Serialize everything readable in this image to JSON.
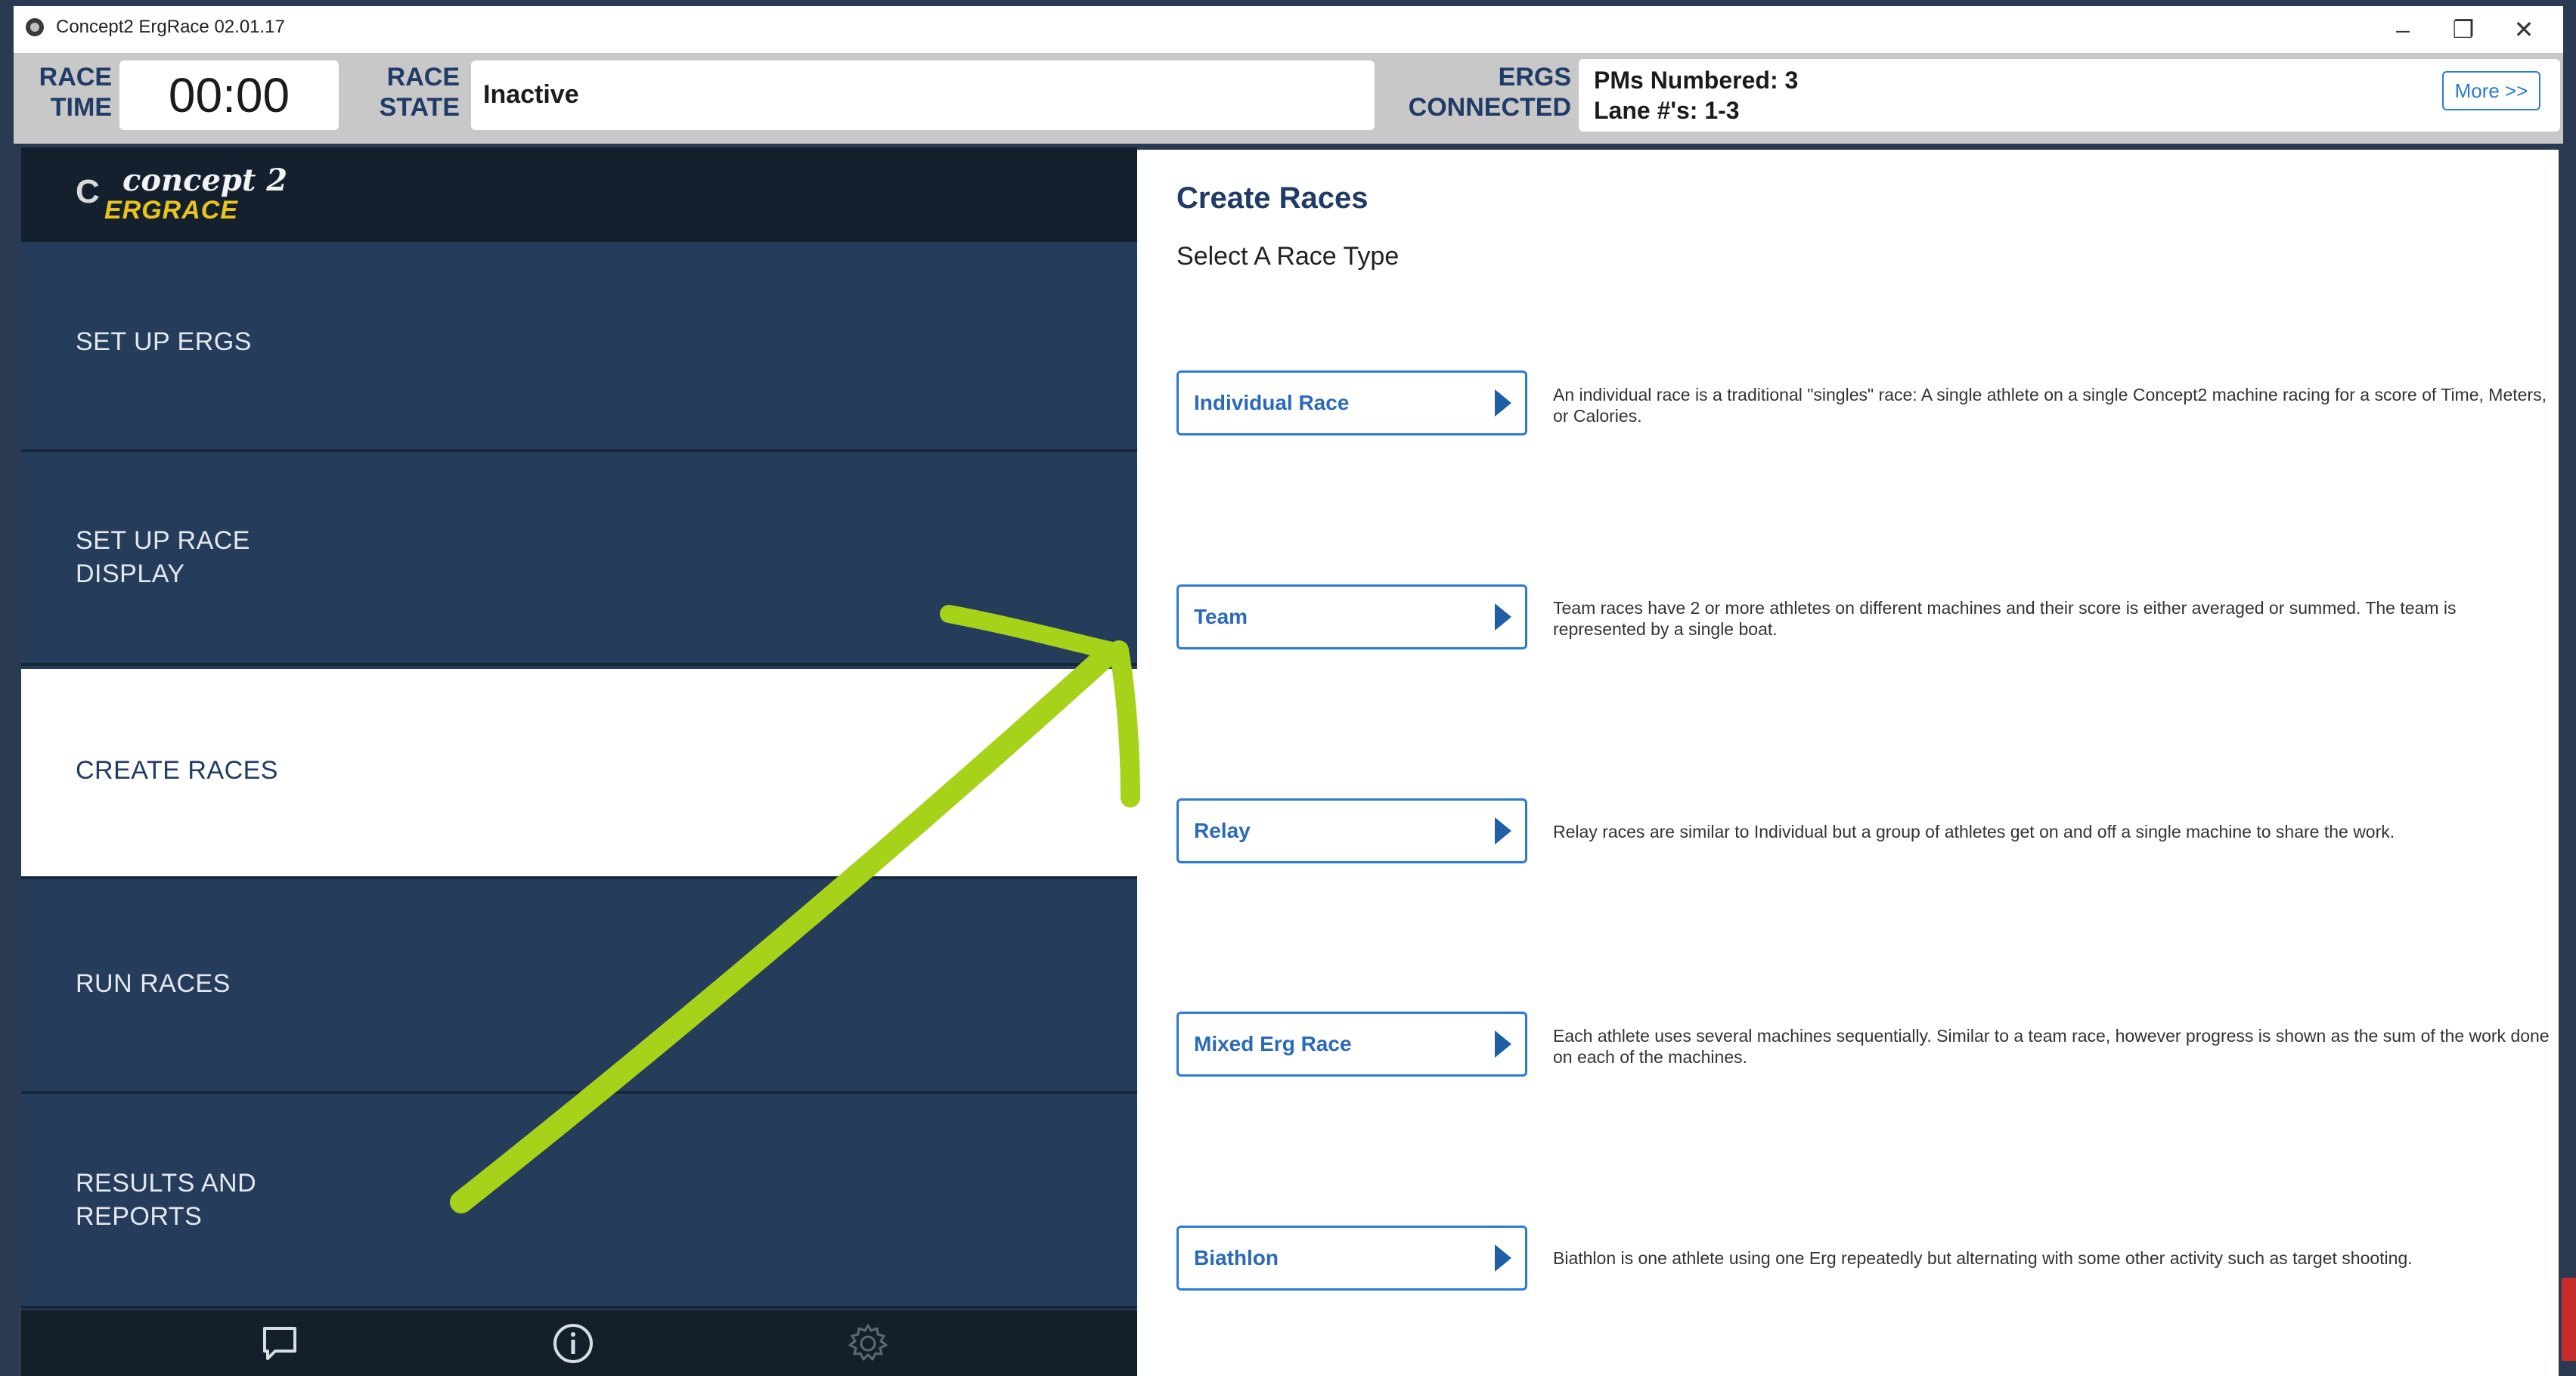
{
  "window": {
    "title": "Concept2 ErgRace 02.01.17",
    "controls": {
      "minimize": "–",
      "restore": "❐",
      "close": "✕"
    }
  },
  "status": {
    "race_time_label": "RACE TIME",
    "race_time_value": "00:00",
    "race_state_label": "RACE STATE",
    "race_state_value": "Inactive",
    "ergs_label": "ERGS CONNECTED",
    "ergs_line1": "PMs Numbered: 3",
    "ergs_line2": "Lane #'s: 1-3",
    "more_button": "More >>"
  },
  "logo": {
    "mark": "C",
    "concept": "concept 2",
    "ergrace": "ERGRACE"
  },
  "sidebar": {
    "items": [
      {
        "label": "SET UP ERGS",
        "active": false
      },
      {
        "label": "SET UP RACE DISPLAY",
        "active": false
      },
      {
        "label": "CREATE RACES",
        "active": true
      },
      {
        "label": "RUN RACES",
        "active": false
      },
      {
        "label": "RESULTS AND REPORTS",
        "active": false
      }
    ],
    "footer_icons": [
      "chat-icon",
      "info-icon",
      "gear-icon"
    ]
  },
  "main": {
    "title": "Create Races",
    "subtitle": "Select A Race Type",
    "race_types": [
      {
        "button": "Individual Race",
        "description": "An individual race is a traditional \"singles\" race: A single athlete on a single Concept2 machine racing for a score of Time, Meters, or Calories."
      },
      {
        "button": "Team",
        "description": "Team races have 2 or more athletes on different machines and their score is either averaged or summed.  The team is represented by a single boat."
      },
      {
        "button": "Relay",
        "description": "Relay races are similar to Individual but a group of athletes get on and off a single machine to share the work."
      },
      {
        "button": "Mixed Erg Race",
        "description": "Each athlete uses several machines sequentially. Similar to a team race, however progress is shown as the sum of the work done on each of the machines."
      },
      {
        "button": "Biathlon",
        "description": "Biathlon is one athlete using one Erg repeatedly but alternating with some other activity such as target shooting."
      }
    ]
  },
  "colors": {
    "accent": "#2a7bd3",
    "sidebar_bg": "#253c5a",
    "header_text": "#1f3b66",
    "annotation_arrow": "#a6d21a",
    "logo_yellow": "#e9c51a"
  }
}
